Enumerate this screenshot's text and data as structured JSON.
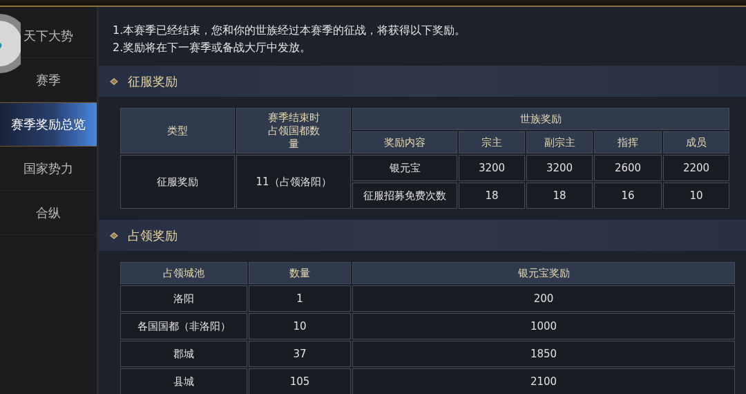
{
  "sidebar": {
    "items": [
      {
        "label": "天下大势",
        "selected": false
      },
      {
        "label": "赛季",
        "selected": false
      },
      {
        "label": "赛季奖励总览",
        "selected": true
      },
      {
        "label": "国家势力",
        "selected": false
      },
      {
        "label": "合纵",
        "selected": false
      }
    ]
  },
  "notice": [
    "1.本赛季已经结束，您和你的世族经过本赛季的征战，将获得以下奖励。",
    "2.奖励将在下一赛季或备战大厅中发放。"
  ],
  "sections": [
    {
      "title": "征服奖励",
      "kind": "conquest",
      "table": {
        "columns": [
          "类型",
          "赛季结束时占领国都数量"
        ],
        "group": "世族奖励",
        "group_columns": [
          "奖励内容",
          "宗主",
          "副宗主",
          "指挥",
          "成员"
        ],
        "rows": [
          {
            "type": "征服奖励",
            "count": "11（占领洛阳）",
            "items": [
              {
                "content": "银元宝",
                "values": [
                  "3200",
                  "3200",
                  "2600",
                  "2200"
                ]
              },
              {
                "content": "征服招募免费次数",
                "values": [
                  "18",
                  "18",
                  "16",
                  "10"
                ]
              }
            ]
          }
        ]
      }
    },
    {
      "title": "占领奖励",
      "kind": "occupation",
      "table": {
        "columns": [
          "占领城池",
          "数量",
          "银元宝奖励"
        ],
        "rows": [
          [
            "洛阳",
            "1",
            "200"
          ],
          [
            "各国国都（非洛阳）",
            "10",
            "1000"
          ],
          [
            "郡城",
            "37",
            "1850"
          ],
          [
            "县城",
            "105",
            "2100"
          ]
        ]
      }
    }
  ]
}
